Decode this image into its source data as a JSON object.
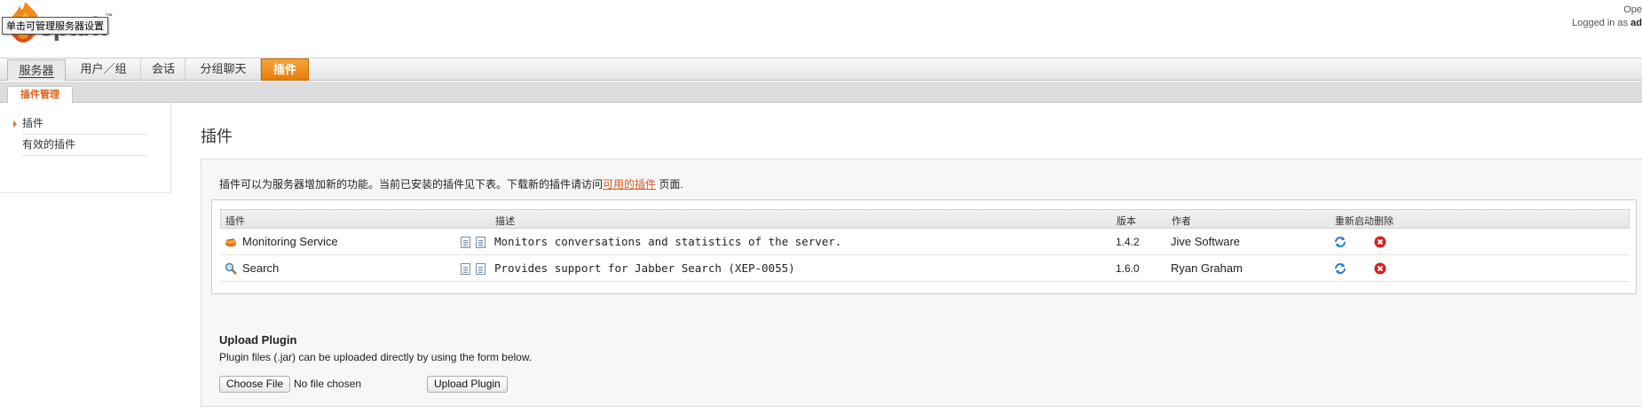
{
  "header": {
    "logo_text": "spark",
    "logo_tm": "™",
    "tooltip": "单击可管理服务器设置",
    "right_line1": "Ope",
    "right_line2_prefix": "Logged in as ",
    "right_line2_user": "ad"
  },
  "tabs": [
    {
      "label": "服务器"
    },
    {
      "label": "用户／组"
    },
    {
      "label": "会话"
    },
    {
      "label": "分组聊天"
    },
    {
      "label": "插件"
    }
  ],
  "subtab": "插件管理",
  "sidebar": {
    "items": [
      {
        "label": "插件"
      },
      {
        "label": "有效的插件"
      }
    ]
  },
  "main": {
    "title": "插件",
    "intro_prefix": "插件可以为服务器增加新的功能。当前已安装的插件见下表。下载新的插件请访问",
    "intro_link": "可用的插件",
    "intro_suffix": " 页面."
  },
  "table": {
    "headers": {
      "plugin": "插件",
      "desc": "描述",
      "version": "版本",
      "author": "作者",
      "restart": "重新启动",
      "delete": "删除"
    },
    "rows": [
      {
        "name": "Monitoring Service",
        "desc": "Monitors conversations and statistics of the server.",
        "version": "1.4.2",
        "author": "Jive Software",
        "icon": "monitoring-icon"
      },
      {
        "name": "Search",
        "desc": "Provides support for Jabber Search (XEP-0055)",
        "version": "1.6.0",
        "author": "Ryan Graham",
        "icon": "magnifier-icon"
      }
    ]
  },
  "upload": {
    "title": "Upload Plugin",
    "desc": "Plugin files (.jar) can be uploaded directly by using the form below.",
    "choose_label": "Choose File",
    "no_file": "No file chosen",
    "upload_label": "Upload Plugin"
  },
  "colors": {
    "accent": "#e67d0a",
    "link": "#d8561c",
    "delete": "#d62020",
    "refresh": "#2a7bd6"
  }
}
